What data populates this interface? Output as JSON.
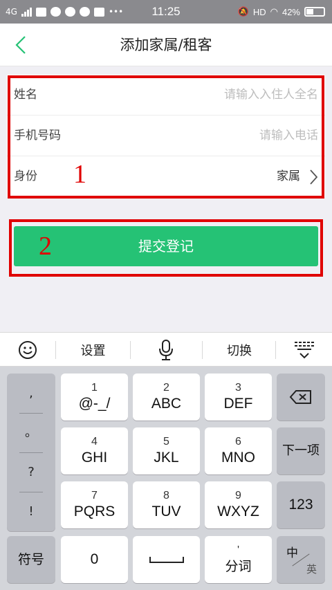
{
  "status_bar": {
    "network": "4G",
    "time": "11:25",
    "hd": "HD",
    "battery": "42%"
  },
  "header": {
    "title": "添加家属/租客"
  },
  "form": {
    "name_label": "姓名",
    "name_placeholder": "请输入入住人全名",
    "phone_label": "手机号码",
    "phone_placeholder": "请输入电话",
    "identity_label": "身份",
    "identity_value": "家属"
  },
  "annotations": {
    "label_1": "1",
    "label_2": "2",
    "color": "#e00000"
  },
  "submit": {
    "label": "提交登记",
    "color": "#25c275"
  },
  "keyboard": {
    "toolbar": {
      "settings": "设置",
      "switch": "切换"
    },
    "punct": [
      ",",
      "。",
      "?",
      "!"
    ],
    "keys": [
      {
        "num": "1",
        "letters": "@-_/"
      },
      {
        "num": "2",
        "letters": "ABC"
      },
      {
        "num": "3",
        "letters": "DEF"
      },
      {
        "num": "4",
        "letters": "GHI"
      },
      {
        "num": "5",
        "letters": "JKL"
      },
      {
        "num": "6",
        "letters": "MNO"
      },
      {
        "num": "7",
        "letters": "PQRS"
      },
      {
        "num": "8",
        "letters": "TUV"
      },
      {
        "num": "9",
        "letters": "WXYZ"
      }
    ],
    "next_item": "下一项",
    "numeric": "123",
    "symbols": "符号",
    "zero": "0",
    "fenci_top": "'",
    "fenci": "分词",
    "zh": "中",
    "en": "英"
  }
}
